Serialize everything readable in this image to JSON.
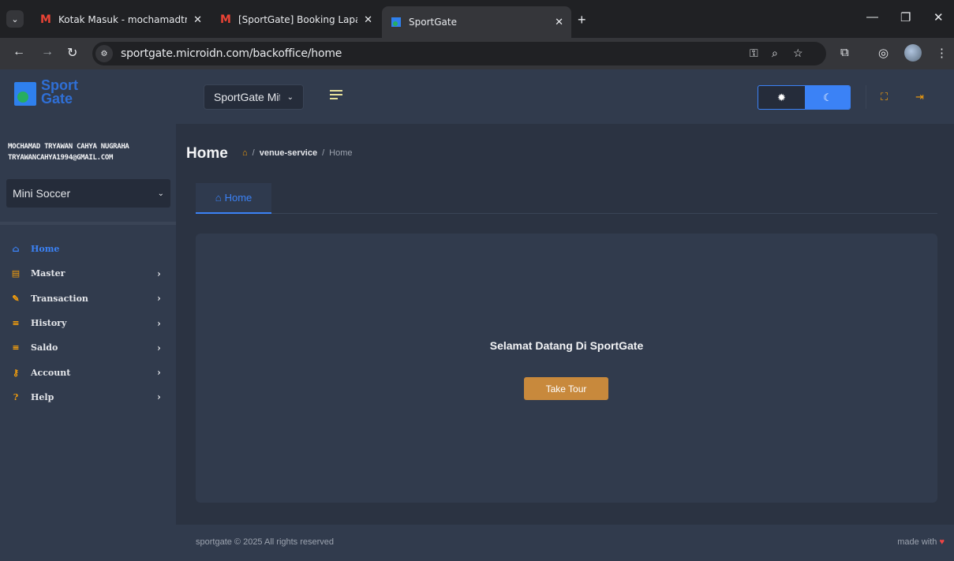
{
  "browser": {
    "tabs": [
      {
        "title": "Kotak Masuk - mochamadtryaw",
        "icon": "gmail-icon"
      },
      {
        "title": "[SportGate] Booking Lapangan",
        "icon": "gmail-icon"
      },
      {
        "title": "SportGate",
        "icon": "sportgate-favicon",
        "active": true
      }
    ],
    "url": "sportgate.microidn.com/backoffice/home"
  },
  "header": {
    "logo_text": "Sport Gate",
    "venue_select": "SportGate Mitra",
    "theme": "dark"
  },
  "sidebar": {
    "user_name": "MOCHAMAD TRYAWAN CAHYA NUGRAHA",
    "user_email": "TRYAWANCAHYA1994@GMAIL.COM",
    "sport_select": "Mini Soccer",
    "items": [
      {
        "label": "Home",
        "icon": "home-icon",
        "active": true
      },
      {
        "label": "Master",
        "icon": "database-icon"
      },
      {
        "label": "Transaction",
        "icon": "edit-icon"
      },
      {
        "label": "History",
        "icon": "list-icon"
      },
      {
        "label": "Saldo",
        "icon": "list-icon"
      },
      {
        "label": "Account",
        "icon": "key-icon"
      },
      {
        "label": "Help",
        "icon": "help-icon"
      }
    ]
  },
  "main": {
    "title": "Home",
    "breadcrumb": {
      "separator": "/",
      "link": "venue-service",
      "current": "Home"
    },
    "tab_label": "Home",
    "welcome": "Selamat Datang Di SportGate",
    "tour_button": "Take Tour"
  },
  "footer": {
    "copyright": "sportgate © 2025 All rights reserved",
    "made_with": "made with"
  },
  "colors": {
    "accent": "#3b82f6",
    "button": "#c8893c",
    "background": "#2b3342",
    "panel": "#313b4d"
  }
}
